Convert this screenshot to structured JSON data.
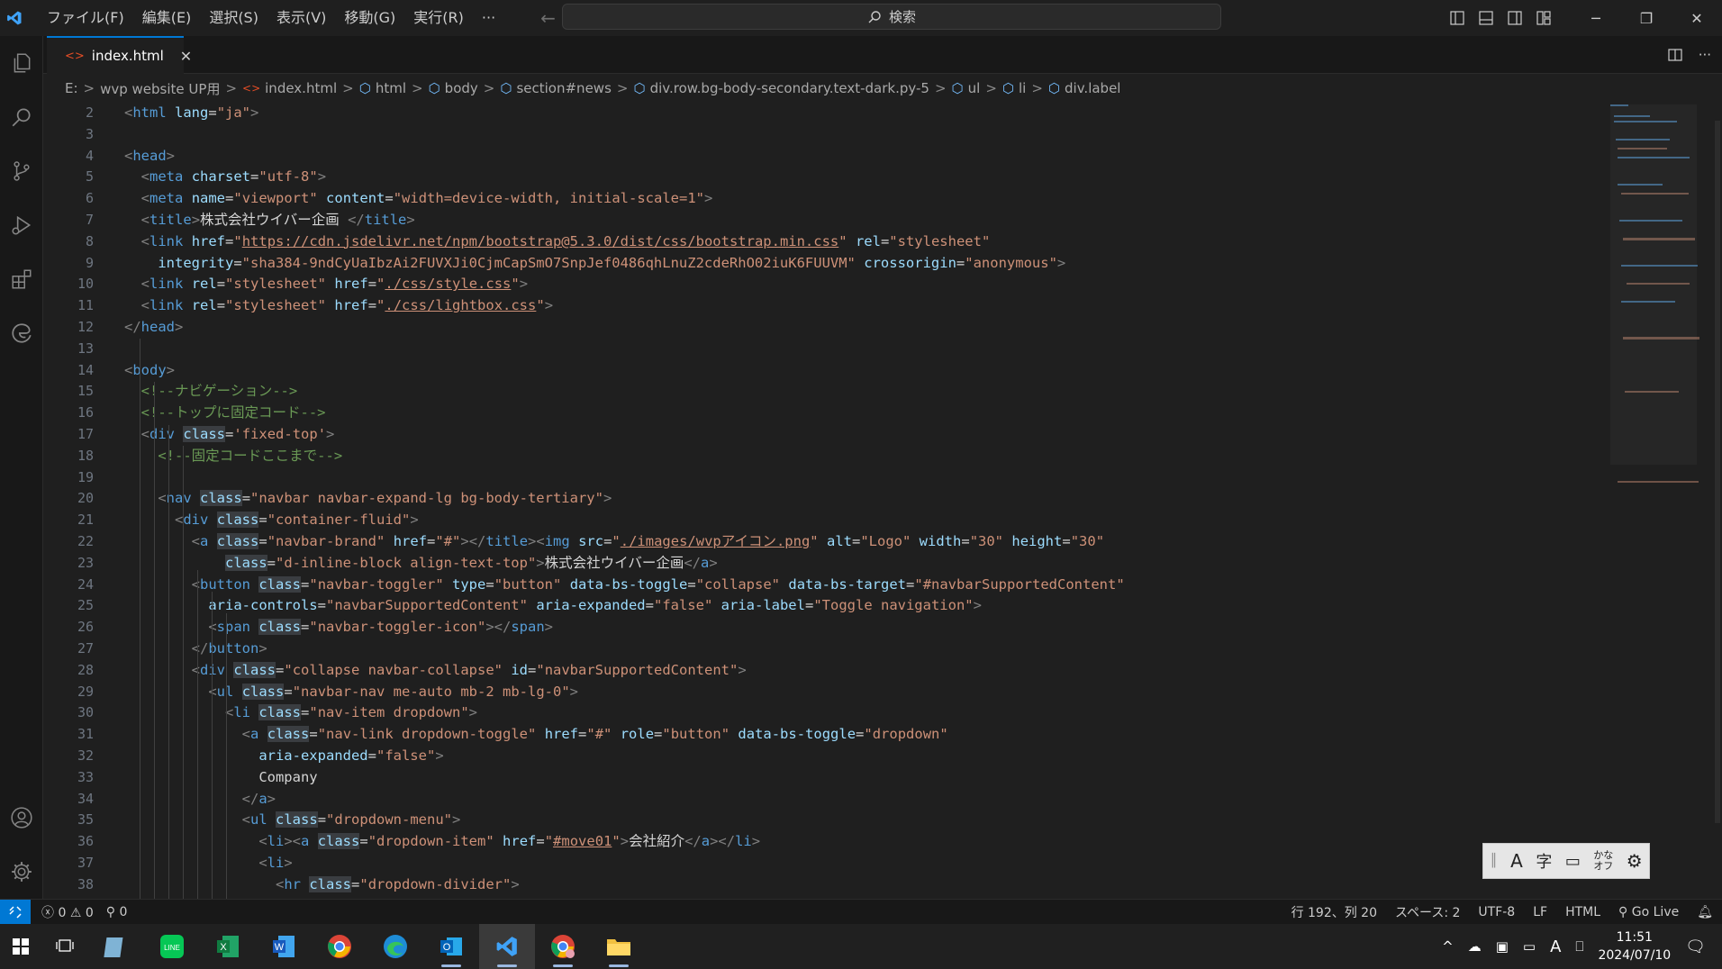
{
  "titlebar": {
    "menu": [
      "ファイル(F)",
      "編集(E)",
      "選択(S)",
      "表示(V)",
      "移動(G)",
      "実行(R)",
      "···"
    ],
    "search_placeholder": "検索"
  },
  "tab": {
    "label": "index.html",
    "close": "✕"
  },
  "breadcrumb": [
    "E:",
    "wvp website UP用",
    "index.html",
    "html",
    "body",
    "section#news",
    "div.row.bg-body-secondary.text-dark.py-5",
    "ul",
    "li",
    "div.label"
  ],
  "editor": {
    "line_numbers": [
      "2",
      "3",
      "4",
      "5",
      "6",
      "7",
      "8",
      "9",
      "10",
      "11",
      "12",
      "13",
      "14",
      "15",
      "16",
      "17",
      "18",
      "19",
      "20",
      "21",
      "22",
      "23",
      "24",
      "25",
      "26",
      "27",
      "28",
      "29",
      "30",
      "31",
      "32",
      "33",
      "34",
      "35",
      "36",
      "37",
      "38"
    ]
  },
  "status": {
    "errors": "0",
    "warnings": "0",
    "ports": "0",
    "position": "行 192、列 20",
    "spaces": "スペース: 2",
    "encoding": "UTF-8",
    "eol": "LF",
    "language": "HTML",
    "golive": "Go Live"
  },
  "ime": {
    "kana": "かな オフ"
  },
  "taskbar": {
    "time": "11:51",
    "date": "2024/07/10"
  },
  "colors": {
    "accent": "#0078d4",
    "background": "#1f1f1f",
    "tag": "#569cd6",
    "attribute": "#9cdcfe",
    "string": "#ce9178",
    "comment": "#6a9955"
  }
}
